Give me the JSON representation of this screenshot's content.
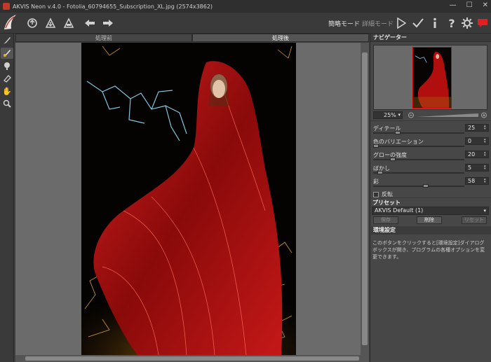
{
  "window": {
    "title": "AKVIS Neon v.4.0 - Fotolia_60794655_Subscription_XL.jpg (2574x3862)",
    "controls": [
      "—",
      "☐",
      "✕"
    ]
  },
  "toolbar": {
    "mode_express": "簡略モード",
    "mode_advanced": "詳細モード",
    "icons": [
      "open-icon",
      "save-icon",
      "print-icon",
      "undo-icon",
      "redo-icon",
      "run-icon",
      "apply-icon",
      "info-icon",
      "help-icon",
      "settings-icon",
      "news-icon"
    ]
  },
  "tabs": {
    "before": "処理前",
    "after": "処理後"
  },
  "navigator": {
    "title": "ナビゲーター",
    "zoom": "25%"
  },
  "params": [
    {
      "label": "ディテール",
      "value": "25",
      "level": 0.25
    },
    {
      "label": "色のバリエーション",
      "value": "0",
      "level": 0.0
    },
    {
      "label": "グローの強度",
      "value": "20",
      "level": 0.2
    },
    {
      "label": "ぼかし",
      "value": "5",
      "level": 0.05
    },
    {
      "label": "彩",
      "value": "58",
      "level": 0.58
    }
  ],
  "invert_label": "反転",
  "preset": {
    "title": "プリセット",
    "selected": "AKVIS Default (1)",
    "save": "保存",
    "delete": "削除",
    "reset": "リセット"
  },
  "help": {
    "title": "環境設定",
    "text": "このボタンをクリックすると[環境設定]ダイアログボックスが開き、プログラムの各種オプションを変更できます。"
  },
  "colors": {
    "accent_red": "#c0392b",
    "cloak_red": "#b10e0e"
  }
}
